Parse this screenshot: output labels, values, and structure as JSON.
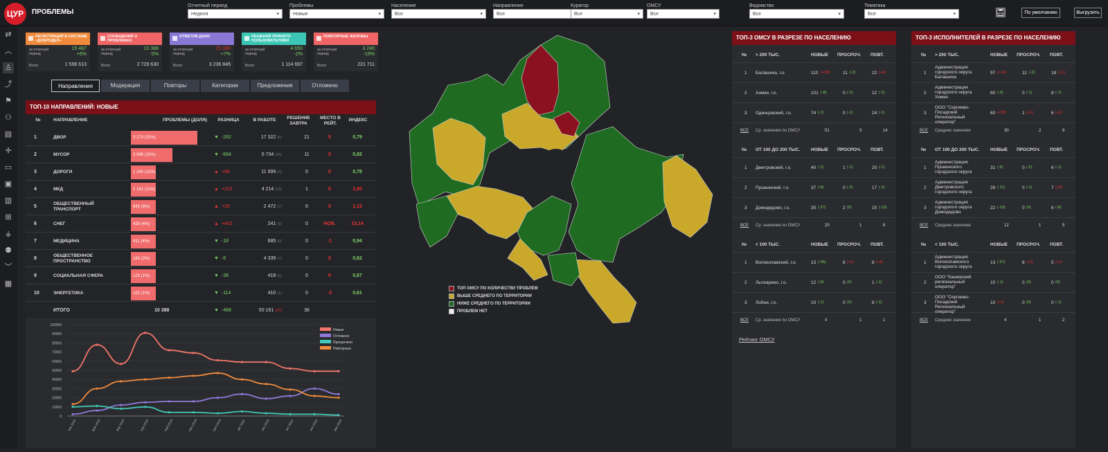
{
  "app": {
    "logo": "ЦУР",
    "title": "ПРОБЛЕМЫ"
  },
  "filters": [
    {
      "label": "Отчетный период",
      "value": "Неделя"
    },
    {
      "label": "Проблемы",
      "value": "Новые"
    },
    {
      "label": "Население",
      "value": "Все"
    },
    {
      "label": "Направление",
      "value": "Все"
    },
    {
      "label": "Куратор",
      "value": "Все"
    },
    {
      "label": "ОМСУ",
      "value": "Все"
    },
    {
      "label": "Ведомство",
      "value": "Все"
    },
    {
      "label": "Тематика",
      "value": "Все"
    }
  ],
  "toolbar": {
    "save_icon": "floppy-icon",
    "default_label": "По умолчанию",
    "export_label": "Выгрузить"
  },
  "kpis": [
    {
      "title": "РЕГИСТРАЦИЙ В СИСТЕМЕ «ДОБРОДЕЛ»",
      "color": "#f08a3c",
      "period_label": "за отчетный период",
      "value": "15 487",
      "pct": "+6%",
      "total_label": "Всего",
      "total": "1 596 613"
    },
    {
      "title": "СООБЩЕНИЙ О ПРОБЛЕМАХ",
      "color": "#ef6464",
      "period_label": "за отчетный период",
      "value": "10 388",
      "pct": "-5%",
      "total_label": "Всего",
      "total": "2 729 630"
    },
    {
      "title": "ОТВЕТОВ ДАНО",
      "color": "#8a78d6",
      "period_label": "за отчетный период",
      "value": "21 080",
      "pct": "+7%",
      "total_label": "Всего",
      "total": "3 236 845"
    },
    {
      "title": "РЕШЕНИЙ ПРИНЯТО ПОЛЬЗОВАТЕЛЯМИ",
      "color": "#3cc6b6",
      "period_label": "за отчетный период",
      "value": "4 650",
      "pct": "-2%",
      "total_label": "Всего",
      "total": "1 114 697"
    },
    {
      "title": "ПОВТОРНЫЕ ЖАЛОБЫ",
      "color": "#ef6464",
      "period_label": "за отчетный период",
      "value": "3 240",
      "pct": "-19%",
      "total_label": "Всего",
      "total": "221 711"
    }
  ],
  "tabs": [
    "Направления",
    "Модерация",
    "Повторы",
    "Категории",
    "Предложения",
    "Отложено"
  ],
  "top10": {
    "title": "ТОП-10 НАПРАВЛЕНИЙ: НОВЫЕ",
    "headers": [
      "№",
      "НАПРАВЛЕНИЕ",
      "ПРОБЛЕМЫ (ДОЛЯ)",
      "РАЗНИЦА",
      "В РАБОТЕ",
      "РЕШЕНИЕ ЗАВТРА",
      "МЕСТО В РЕЙТ.",
      "ИНДЕКС"
    ],
    "rows": [
      {
        "n": "1",
        "name": "ДВОР",
        "share": "3 273 (32%)",
        "pct": 32,
        "diff": "-262",
        "dir": "down",
        "work": "17 322",
        "work_d": "(5)",
        "tomorrow": "21",
        "place": "0",
        "index": "0,79",
        "index_good": true
      },
      {
        "n": "2",
        "name": "МУСОР",
        "share": "3 096 (20%)",
        "pct": 20,
        "diff": "-664",
        "dir": "down",
        "work": "5 734",
        "work_d": "(16)",
        "tomorrow": "11",
        "place": "0",
        "index": "0,82",
        "index_good": true
      },
      {
        "n": "3",
        "name": "ДОРОГИ",
        "share": "1 240 (12%)",
        "pct": 12,
        "diff": "+68",
        "dir": "up",
        "work": "11 999",
        "work_d": "(4)",
        "tomorrow": "0",
        "place": "0",
        "index": "0,78",
        "index_good": true
      },
      {
        "n": "4",
        "name": "МКД",
        "share": "1 161 (11%)",
        "pct": 11,
        "diff": "+113",
        "dir": "up",
        "work": "4 214",
        "work_d": "(18)",
        "tomorrow": "1",
        "place": "0",
        "index": "1,00",
        "index_good": false
      },
      {
        "n": "5",
        "name": "ОБЩЕСТВЕННЫЙ ТРАНСПОРТ",
        "share": "845 (8%)",
        "pct": 8,
        "diff": "+33",
        "dir": "up",
        "work": "2 472",
        "work_d": "(7)",
        "tomorrow": "0",
        "place": "0",
        "index": "1,12",
        "index_good": false
      },
      {
        "n": "6",
        "name": "СНЕГ",
        "share": "428 (4%)",
        "pct": 4,
        "diff": "+403",
        "dir": "up",
        "work": "241",
        "work_d": "(0)",
        "tomorrow": "0",
        "place": "НОВ.",
        "index": "13,14",
        "index_good": false
      },
      {
        "n": "7",
        "name": "МЕДИЦИНА",
        "share": "411 (4%)",
        "pct": 4,
        "diff": "-18",
        "dir": "down",
        "work": "685",
        "work_d": "(0)",
        "tomorrow": "0",
        "place": "-1",
        "index": "0,94",
        "index_good": true
      },
      {
        "n": "8",
        "name": "ОБЩЕСТВЕННОЕ ПРОСТРАНСТВО",
        "share": "183 (2%)",
        "pct": 2,
        "diff": "-8",
        "dir": "down",
        "work": "4 339",
        "work_d": "(7)",
        "tomorrow": "0",
        "place": "0",
        "index": "0,62",
        "index_good": true
      },
      {
        "n": "9",
        "name": "СОЦИАЛЬНАЯ СФЕРА",
        "share": "123 (1%)",
        "pct": 1,
        "diff": "-38",
        "dir": "down",
        "work": "418",
        "work_d": "(0)",
        "tomorrow": "0",
        "place": "0",
        "index": "0,67",
        "index_good": true
      },
      {
        "n": "10",
        "name": "ЭНЕРГЕТИКА",
        "share": "102 (1%)",
        "pct": 1,
        "diff": "-114",
        "dir": "down",
        "work": "410",
        "work_d": "(1)",
        "tomorrow": "0",
        "place": "-3",
        "index": "0,61",
        "index_good": true
      }
    ],
    "total": {
      "label": "ИТОГО",
      "share": "10 388",
      "diff": "-468",
      "work": "50 191",
      "work_d": "(37)",
      "tomorrow": "36"
    }
  },
  "chart_data": {
    "type": "line",
    "categories": [
      "янв 2019",
      "фев 2019",
      "мар 2019",
      "апр 2019",
      "май 2019",
      "июн 2019",
      "июл 2019",
      "авг 2019",
      "сен 2019",
      "окт 2019",
      "ноя 2019",
      "дек 2019"
    ],
    "ylim": [
      0,
      100000
    ],
    "yticks": [
      "100000",
      "90000",
      "80000",
      "70000",
      "60000",
      "50000",
      "40000",
      "30000",
      "20000",
      "10000",
      "0"
    ],
    "series": [
      {
        "name": "Новые",
        "color": "#f2766b",
        "values": [
          49000,
          78000,
          57000,
          91000,
          72000,
          69000,
          61000,
          59000,
          59000,
          52000,
          49000,
          49000
        ]
      },
      {
        "name": "Отложено",
        "color": "#8f79d8",
        "values": [
          2000,
          6000,
          12000,
          15000,
          16000,
          16000,
          20000,
          24000,
          19000,
          22000,
          30000,
          24000
        ]
      },
      {
        "name": "Просрочено",
        "color": "#42c9b8",
        "values": [
          10000,
          11000,
          8000,
          10000,
          4000,
          4000,
          3000,
          5000,
          3000,
          2000,
          2000,
          1000
        ]
      },
      {
        "name": "Повторные",
        "color": "#f08a3c",
        "values": [
          13000,
          30000,
          38000,
          40000,
          42000,
          44000,
          47000,
          40000,
          35000,
          29000,
          22000,
          20000
        ]
      }
    ]
  },
  "map": {
    "legend": [
      {
        "label": "ТОП ОМСУ ПО КОЛИЧЕСТВУ ПРОБЛЕМ",
        "color": "#8b1020"
      },
      {
        "label": "ВЫШЕ СРЕДНЕГО ПО ТЕРРИТОРИИ",
        "color": "#c9a82a"
      },
      {
        "label": "НИЖЕ СРЕДНЕГО ПО ТЕРРИТОРИИ",
        "color": "#1f6b22"
      },
      {
        "label": "ПРОБЛЕМ НЕТ",
        "color": "#eeeeee"
      }
    ]
  },
  "omsu": {
    "title": "ТОП-3 ОМСУ В РАЗРЕЗЕ ПО НАСЕЛЕНИЮ",
    "link": "Рейтинг ОМСУ",
    "sections": [
      {
        "group": "> 200 ТЫС.",
        "cols": [
          "№",
          "НОВЫЕ",
          "ПРОСРОЧ.",
          "ПОВТ."
        ],
        "rows": [
          {
            "n": "1",
            "name": "Балашиха, г.о.",
            "new": "110",
            "new_d": "(+18)",
            "late": "11",
            "late_d": "(-2)",
            "rep": "22",
            "rep_d": "(+4)"
          },
          {
            "n": "2",
            "name": "Химки, г.о.",
            "new": "101",
            "new_d": "(-8)",
            "late": "0",
            "late_d": "(-1)",
            "rep": "12",
            "rep_d": "(-1)"
          },
          {
            "n": "3",
            "name": "Одинцовский, г.о.",
            "new": "74",
            "new_d": "(-1)",
            "late": "0",
            "late_d": "(-1)",
            "rep": "24",
            "rep_d": "(-1)"
          }
        ],
        "avg": {
          "all": "ВСЕ",
          "label": "Ср. значение по ОМСУ",
          "new": "51",
          "late": "3",
          "rep": "14"
        }
      },
      {
        "group": "ОТ 100 ДО 200 ТЫС.",
        "cols": [
          "№",
          "НОВЫЕ",
          "ПРОСРОЧ.",
          "ПОВТ."
        ],
        "rows": [
          {
            "n": "1",
            "name": "Дмитровский, г.о.",
            "new": "40",
            "new_d": "(-1)",
            "late": "1",
            "late_d": "(-1)",
            "rep": "20",
            "rep_d": "(-1)"
          },
          {
            "n": "2",
            "name": "Пушкинский, г.о.",
            "new": "37",
            "new_d": "(-8)",
            "late": "0",
            "late_d": "(-2)",
            "rep": "17",
            "rep_d": "(-1)"
          },
          {
            "n": "3",
            "name": "Домодедово, г.о.",
            "new": "35",
            "new_d": "(-27)",
            "late": "2",
            "late_d": "(0)",
            "rep": "15",
            "rep_d": "(-10)"
          }
        ],
        "avg": {
          "all": "ВСЕ",
          "label": "Ср. значение по ОМСУ",
          "new": "20",
          "late": "1",
          "rep": "8"
        }
      },
      {
        "group": "< 100 ТЫС.",
        "cols": [
          "№",
          "НОВЫЕ",
          "ПРОСРОЧ.",
          "ПОВТ."
        ],
        "rows": [
          {
            "n": "1",
            "name": "Волоколамский, г.о.",
            "new": "13",
            "new_d": "(-35)",
            "late": "8",
            "late_d": "(+2)",
            "rep": "8",
            "rep_d": "(+4)"
          },
          {
            "n": "2",
            "name": "Лыткарино, г.о.",
            "new": "12",
            "new_d": "(-9)",
            "late": "0",
            "late_d": "(0)",
            "rep": "1",
            "rep_d": "(-1)"
          },
          {
            "n": "3",
            "name": "Лобня, г.о.",
            "new": "10",
            "new_d": "(-1)",
            "late": "0",
            "late_d": "(0)",
            "rep": "8",
            "rep_d": "(-1)"
          }
        ],
        "avg": {
          "all": "ВСЕ",
          "label": "Ср. значение по ОМСУ",
          "new": "4",
          "late": "1",
          "rep": "1"
        }
      }
    ]
  },
  "executors": {
    "title": "ТОП-3 ИСПОЛНИТЕЛЕЙ В РАЗРЕЗЕ ПО НАСЕЛЕНИЮ",
    "sections": [
      {
        "group": "> 200 ТЫС.",
        "cols": [
          "№",
          "НОВЫЕ",
          "ПРОСРОЧ.",
          "ПОВТ."
        ],
        "rows": [
          {
            "n": "1",
            "name": "Администрация городского округа Балашиха",
            "new": "97",
            "new_d": "(+14)",
            "late": "11",
            "late_d": "(-2)",
            "rep": "18",
            "rep_d": "(+1)"
          },
          {
            "n": "2",
            "name": "Администрация городского округа Химки",
            "new": "60",
            "new_d": "(-3)",
            "late": "0",
            "late_d": "(-1)",
            "rep": "8",
            "rep_d": "(-1)"
          },
          {
            "n": "3",
            "name": "ООО \"Сергиево-Посадский Региональный оператор\"",
            "new": "60",
            "new_d": "(+33)",
            "late": "1",
            "late_d": "(+1)",
            "rep": "6",
            "rep_d": "(+1)"
          }
        ],
        "avg": {
          "all": "ВСЕ",
          "label": "Среднее значение",
          "new": "30",
          "late": "2",
          "rep": "9"
        }
      },
      {
        "group": "ОТ 100 ДО 200 ТЫС.",
        "cols": [
          "№",
          "НОВЫЕ",
          "ПРОСРОЧ.",
          "ПОВТ."
        ],
        "rows": [
          {
            "n": "1",
            "name": "Администрация Пушкинского городского округа",
            "new": "31",
            "new_d": "(-6)",
            "late": "0",
            "late_d": "(-2)",
            "rep": "6",
            "rep_d": "(-1)"
          },
          {
            "n": "2",
            "name": "Администрация Дмитровского городского округа",
            "new": "28",
            "new_d": "(-11)",
            "late": "0",
            "late_d": "(-1)",
            "rep": "7",
            "rep_d": "(+4)"
          },
          {
            "n": "3",
            "name": "Администрация городского округа Домодедово",
            "new": "22",
            "new_d": "(-10)",
            "late": "0",
            "late_d": "(0)",
            "rep": "6",
            "rep_d": "(-8)"
          }
        ],
        "avg": {
          "all": "ВСЕ",
          "label": "Среднее значение",
          "new": "12",
          "late": "1",
          "rep": "5"
        }
      },
      {
        "group": "< 100 ТЫС.",
        "cols": [
          "№",
          "НОВЫЕ",
          "ПРОСРОЧ.",
          "ПОВТ."
        ],
        "rows": [
          {
            "n": "1",
            "name": "Администрация Волоколамского городского округа",
            "new": "13",
            "new_d": "(-37)",
            "late": "8",
            "late_d": "(+2)",
            "rep": "5",
            "rep_d": "(+1)"
          },
          {
            "n": "2",
            "name": "ООО \"Каширский региональный оператор\"",
            "new": "10",
            "new_d": "(-1)",
            "late": "0",
            "late_d": "(0)",
            "rep": "0",
            "rep_d": "(0)"
          },
          {
            "n": "3",
            "name": "ООО \"Сергиево-Посадский Региональный оператор\"",
            "new": "10",
            "new_d": "(+1)",
            "late": "0",
            "late_d": "(0)",
            "rep": "0",
            "rep_d": "(-1)"
          }
        ],
        "avg": {
          "all": "ВСЕ",
          "label": "Среднее значение",
          "new": "4",
          "late": "1",
          "rep": "2"
        }
      }
    ]
  },
  "sidebar": {
    "icons": [
      "swap-icon",
      "chevron-up-icon",
      "person-icon",
      "route-icon",
      "flag-icon",
      "handshake-icon",
      "document-icon",
      "crosshair-icon",
      "book-icon",
      "bus-icon",
      "clipboard-icon",
      "hierarchy-icon",
      "hand-coins-icon",
      "people-icon",
      "chevron-down-icon",
      "notes-icon"
    ]
  }
}
